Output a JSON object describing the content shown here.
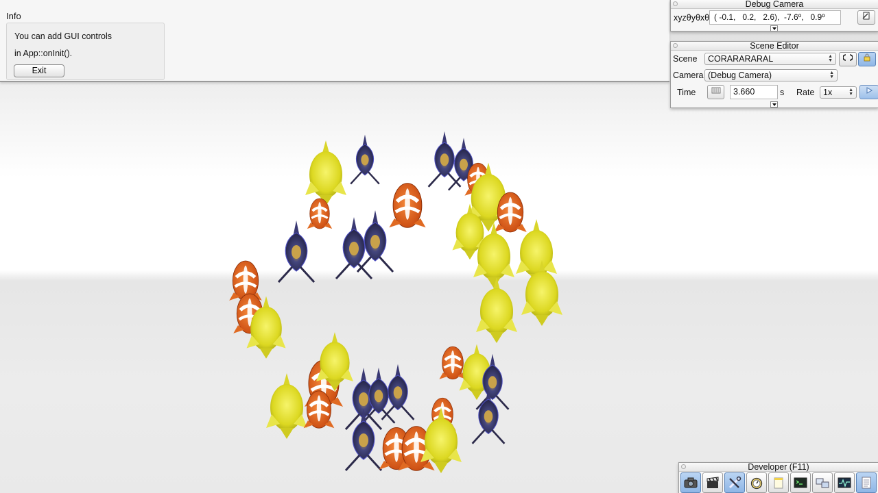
{
  "info": {
    "title": "Info",
    "line1": "You can add GUI controls",
    "line2": "in App::onInit().",
    "exit_label": "Exit"
  },
  "debug_camera": {
    "title": "Debug Camera",
    "label": "xyzθyθxθz",
    "value": "( -0.1,   0.2,   2.6),  -7.6º,   0.9º",
    "copy_icon": "clipboard-copy-icon"
  },
  "scene_editor": {
    "title": "Scene Editor",
    "scene_label": "Scene",
    "scene_value": "CORARARARAL",
    "camera_label": "Camera",
    "camera_value": "(Debug Camera)",
    "time_label": "Time",
    "time_value": "3.660",
    "time_unit": "s",
    "rate_label": "Rate",
    "rate_value": "1x"
  },
  "developer": {
    "title": "Developer (F11)",
    "tools": [
      {
        "icon": "camera-icon"
      },
      {
        "icon": "clapperboard-icon"
      },
      {
        "icon": "tools-icon"
      },
      {
        "icon": "stopwatch-icon"
      },
      {
        "icon": "notepad-icon"
      },
      {
        "icon": "console-icon"
      },
      {
        "icon": "scene-windows-icon"
      },
      {
        "icon": "profiler-icon"
      },
      {
        "icon": "document-icon"
      }
    ]
  },
  "colors": {
    "clownfish": "#ea6a1c",
    "yellow_tang": "#e6e426",
    "blue_fish": "#2f2d6e",
    "accent": "#8fb6e6"
  }
}
